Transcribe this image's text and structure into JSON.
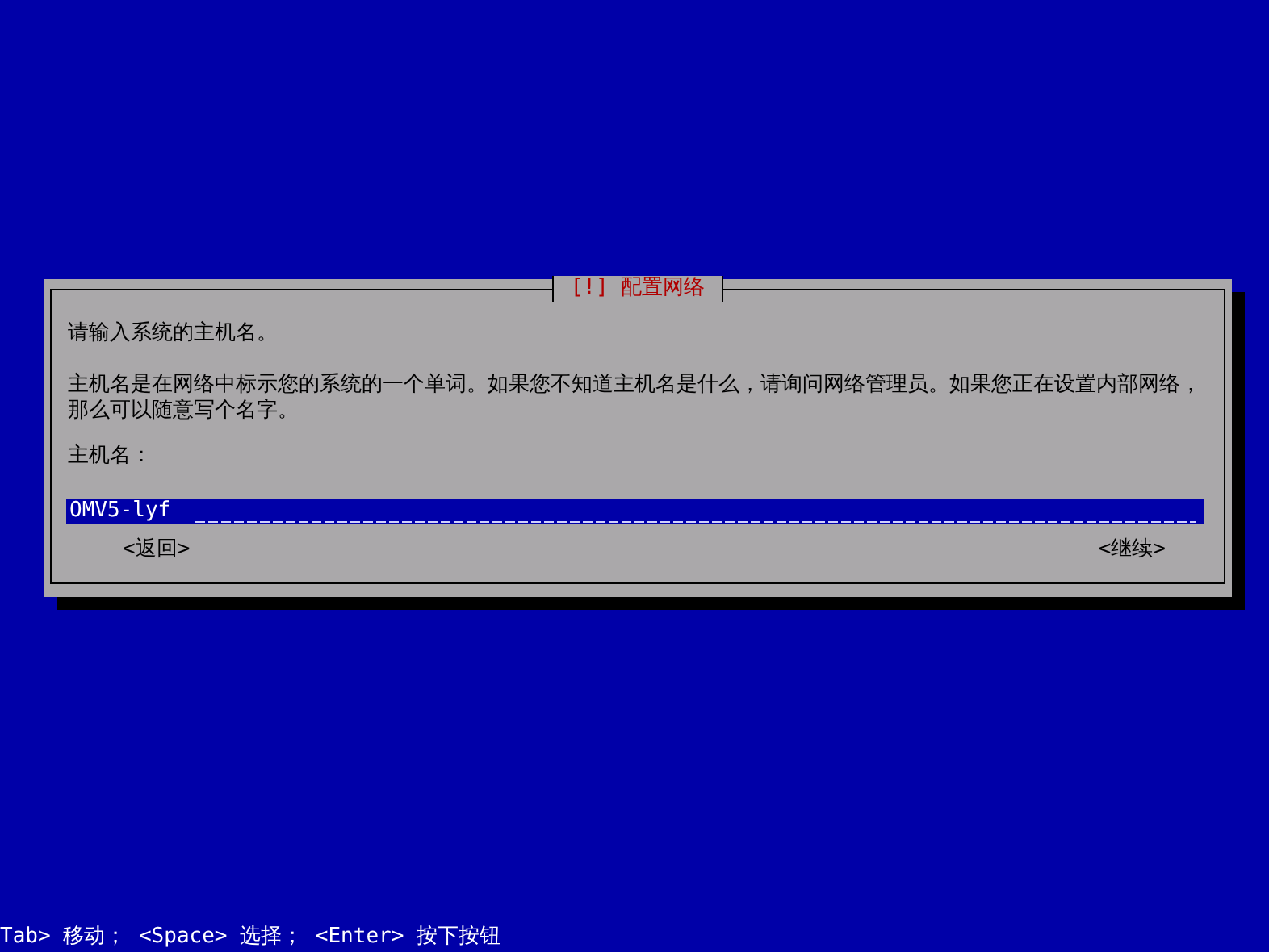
{
  "dialog": {
    "title": "[!] 配置网络",
    "prompt": "请输入系统的主机名。",
    "description": "主机名是在网络中标示您的系统的一个单词。如果您不知道主机名是什么，请询问网络管理员。如果您正在设置内部网络，那么可以随意写个名字。",
    "field_label": "主机名：",
    "field_value": "OMV5-lyf",
    "buttons": [
      {
        "label": "<返回>",
        "selected": false
      },
      {
        "label": "<继续>",
        "selected": false
      }
    ]
  },
  "status_bar": "Tab> 移动； <Space> 选择； <Enter> 按下按钮"
}
